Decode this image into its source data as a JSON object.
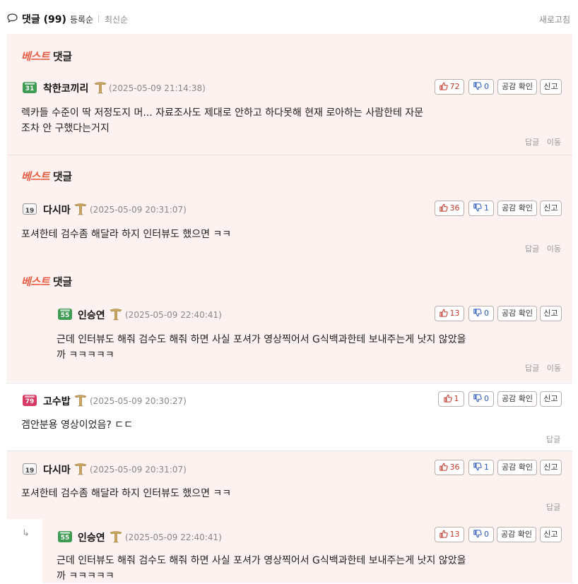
{
  "header": {
    "title": "댓글 (99)",
    "sort_registered": "등록순",
    "sort_latest": "최신순",
    "refresh": "새로고침"
  },
  "best_label": {
    "part1": "베스트",
    "part2": "댓글"
  },
  "buttons": {
    "agree": "공감 확인",
    "report": "신고"
  },
  "actions": {
    "reply": "답글",
    "move": "이동"
  },
  "comments": [
    {
      "level": "31",
      "level_color": "#3f9a53",
      "nickname": "착한코끼리",
      "date": "(2025-05-09 21:14:38)",
      "text": "렉카들 수준이 딱 저정도지 머... 자료조사도 제대로 안하고 하다못해 현재 로아하는 사람한테 자문조차 안 구했다는거지",
      "likes": "72",
      "dislikes": "0"
    },
    {
      "level": "19",
      "level_color": "#f2f2f2",
      "nickname": "다시마",
      "date": "(2025-05-09 20:31:07)",
      "text": "포셔한테 검수좀 해달라 하지 인터뷰도 했으면 ㅋㅋ",
      "likes": "36",
      "dislikes": "1"
    },
    {
      "level": "55",
      "level_color": "#3f9a53",
      "nickname": "인승연",
      "date": "(2025-05-09 22:40:41)",
      "text": "근데 인터뷰도 해줘 검수도 해줘 하면 사실 포셔가 영상찍어서 G식백과한테 보내주는게 낫지 않았을까 ㅋㅋㅋㅋㅋ",
      "likes": "13",
      "dislikes": "0"
    },
    {
      "level": "79",
      "level_color": "#d93a63",
      "nickname": "고수밥",
      "date": "(2025-05-09 20:30:27)",
      "text": "겜안분용 영상이었음? ㄷㄷ",
      "likes": "1",
      "dislikes": "0"
    },
    {
      "level": "19",
      "level_color": "#f2f2f2",
      "nickname": "다시마",
      "date": "(2025-05-09 20:31:07)",
      "text": "포셔한테 검수좀 해달라 하지 인터뷰도 했으면 ㅋㅋ",
      "likes": "36",
      "dislikes": "1"
    },
    {
      "level": "55",
      "level_color": "#3f9a53",
      "nickname": "인승연",
      "date": "(2025-05-09 22:40:41)",
      "text": "근데 인터뷰도 해줘 검수도 해줘 하면 사실 포셔가 영상찍어서 G식백과한테 보내주는게 낫지 않았을까 ㅋㅋㅋㅋㅋ",
      "likes": "13",
      "dislikes": "0"
    }
  ]
}
